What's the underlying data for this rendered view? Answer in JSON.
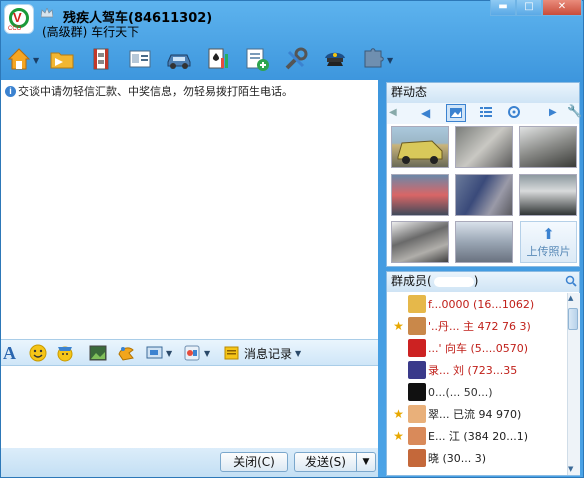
{
  "window": {
    "title": "残疾人驾车(84611302)",
    "subtitle": "(高级群) 车行天下",
    "logo_caption": "CCO",
    "controls": {
      "minimize": "▬",
      "maximize": "□",
      "close": "✕"
    }
  },
  "toolbar": {
    "icons": [
      "home-icon",
      "folder-icon",
      "film-icon",
      "id-card-icon",
      "car-icon",
      "poker-icon",
      "add-note-icon",
      "tools-icon",
      "police-hat-icon",
      "puzzle-icon"
    ]
  },
  "chat": {
    "notice": "交谈中请勿轻信汇款、中奖信息，勿轻易拨打陌生电话。"
  },
  "editbar": {
    "history_label": "消息记录"
  },
  "bottom": {
    "close_label": "关闭(C)",
    "send_label": "发送(S)"
  },
  "group_dynamics": {
    "title": "群动态",
    "upload_label": "上传照片"
  },
  "group_members": {
    "title": "群成员(",
    "members": [
      {
        "name": "f...0000 (16...1062)",
        "color": "#c0201a",
        "star": false
      },
      {
        "name": "'..丹... 主 472 76 3)",
        "color": "#c0201a",
        "star": true
      },
      {
        "name": "...' 向车 (5....0570)",
        "color": "#c0201a",
        "star": false
      },
      {
        "name": "录... 刘 (723...35",
        "color": "#c0201a",
        "star": false
      },
      {
        "name": "0...(... 50...)",
        "color": "#333333",
        "star": false
      },
      {
        "name": "翠... 已流 94 970)",
        "color": "#222222",
        "star": true
      },
      {
        "name": "E... 江 (384 20...1)",
        "color": "#222222",
        "star": true
      },
      {
        "name": "晓 (30... 3)",
        "color": "#222222",
        "star": false
      }
    ]
  }
}
